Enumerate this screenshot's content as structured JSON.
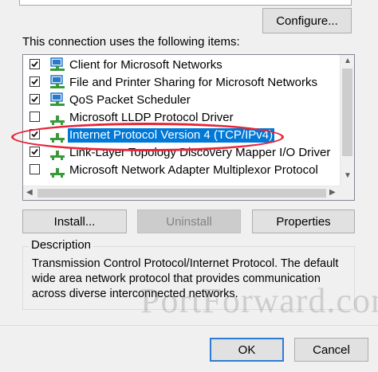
{
  "buttons": {
    "configure": "Configure...",
    "install": "Install...",
    "uninstall": "Uninstall",
    "properties": "Properties",
    "ok": "OK",
    "cancel": "Cancel"
  },
  "items_label": "This connection uses the following items:",
  "items": [
    {
      "label": "Client for Microsoft Networks",
      "checked": true,
      "icon": "network-client-icon",
      "selected": false
    },
    {
      "label": "File and Printer Sharing for Microsoft Networks",
      "checked": true,
      "icon": "network-service-icon",
      "selected": false
    },
    {
      "label": "QoS Packet Scheduler",
      "checked": true,
      "icon": "network-service-icon",
      "selected": false
    },
    {
      "label": "Microsoft LLDP Protocol Driver",
      "checked": false,
      "icon": "network-protocol-icon",
      "selected": false
    },
    {
      "label": "Internet Protocol Version 4 (TCP/IPv4)",
      "checked": true,
      "icon": "network-protocol-icon",
      "selected": true
    },
    {
      "label": "Link-Layer Topology Discovery Mapper I/O Driver",
      "checked": true,
      "icon": "network-protocol-icon",
      "selected": false
    },
    {
      "label": "Microsoft Network Adapter Multiplexor Protocol",
      "checked": false,
      "icon": "network-protocol-icon",
      "selected": false
    }
  ],
  "description": {
    "title": "Description",
    "text": "Transmission Control Protocol/Internet Protocol. The default\nwide area network protocol that provides communication\nacross diverse interconnected networks."
  },
  "watermark": "PortForward.com",
  "colors": {
    "selection": "#0078d7",
    "highlight_ellipse": "#e5263a",
    "primary_border": "#2f7bd4",
    "network_icon_green": "#3a9a3a",
    "network_icon_blue": "#2a78c8"
  }
}
